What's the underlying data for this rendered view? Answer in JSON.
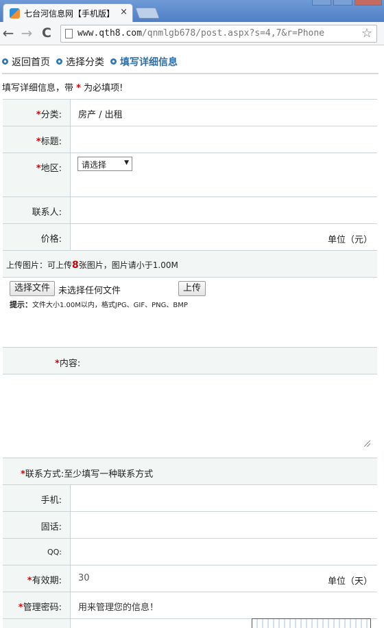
{
  "browser": {
    "tab_title": "七台河信息网【手机版】",
    "tab_close": "×",
    "url_host": "www.qth8.com",
    "url_path": "/qnmlgb678/post.aspx?s=4,7&r=Phone",
    "back_glyph": "←",
    "forward_glyph": "→",
    "reload_glyph": "C",
    "star_glyph": "☆",
    "icons": [
      "back-arrow-icon",
      "forward-arrow-icon",
      "reload-icon",
      "page-icon",
      "star-icon",
      "close-icon"
    ]
  },
  "breadcrumb": {
    "items": [
      "返回首页",
      "选择分类",
      "填写详细信息"
    ]
  },
  "intro": {
    "before": "填写详细信息，带",
    "star": "*",
    "after": "为必填项!"
  },
  "form": {
    "required_mark": "*",
    "category": {
      "label": "分类:",
      "value": "房产 / 出租"
    },
    "title": {
      "label": "标题:",
      "value": ""
    },
    "region": {
      "label": "地区:",
      "select_value": "请选择",
      "arrow": "▼"
    },
    "contact_person": {
      "label": "联系人:",
      "value": ""
    },
    "price": {
      "label": "价格:",
      "value": "",
      "unit": "单位（元）"
    },
    "upload": {
      "label_prefix": "上传图片：可上传",
      "max_count": "8",
      "label_suffix": "张图片，图片请小于1.00M",
      "choose_button": "选择文件",
      "file_status": "未选择任何文件",
      "upload_button": "上传",
      "hint_label": "提示：",
      "hint_text": "文件大小1.00M以内，格式JPG、GIF、PNG、BMP"
    },
    "content": {
      "label": "内容:",
      "value": ""
    },
    "contact_methods": {
      "label": "联系方式:",
      "note": "至少填写一种联系方式"
    },
    "mobile": {
      "label": "手机:",
      "value": ""
    },
    "phone": {
      "label": "固话:",
      "value": ""
    },
    "qq": {
      "label": "QQ:",
      "value": ""
    },
    "validity": {
      "label": "有效期:",
      "value": "30",
      "unit": "单位（天）"
    },
    "password": {
      "label": "管理密码:",
      "placeholder": "用来管理您的信息！"
    }
  }
}
